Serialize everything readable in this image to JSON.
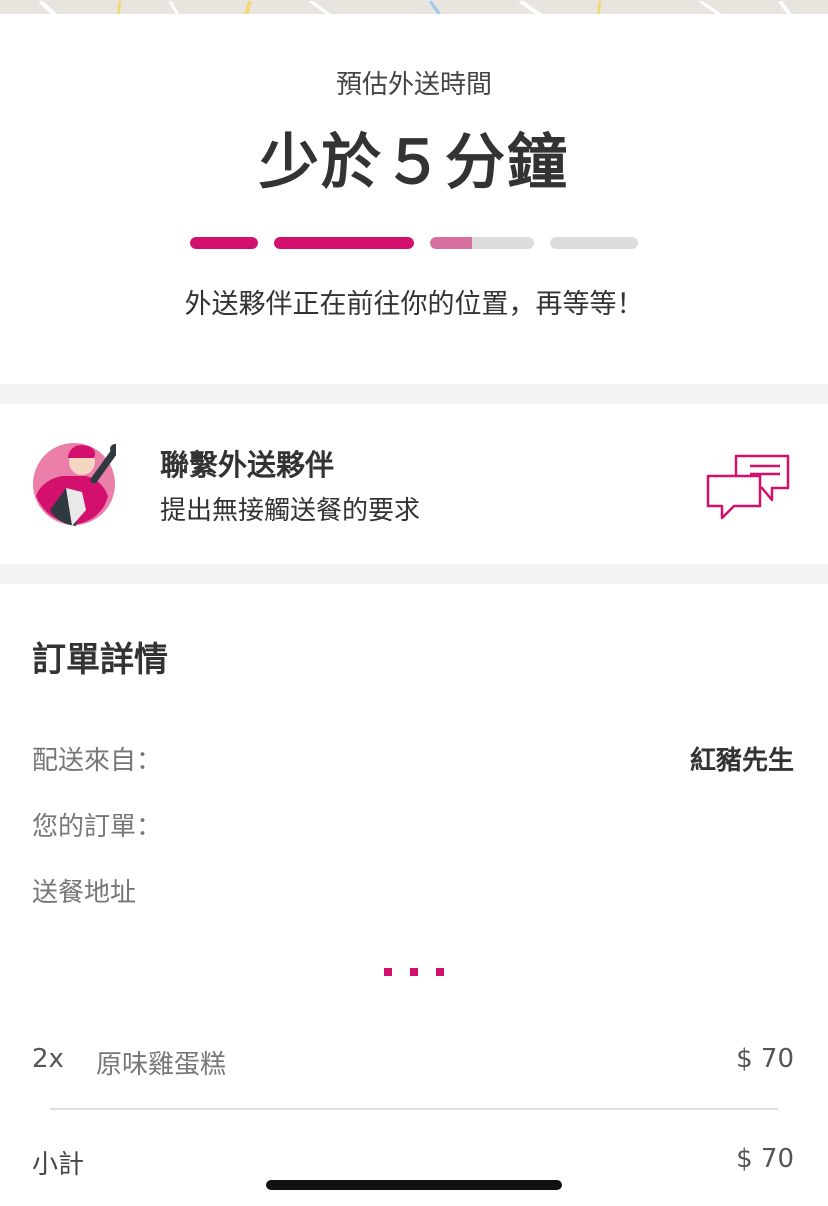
{
  "colors": {
    "accent": "#d3106e",
    "accent_light": "#d8709f",
    "track": "#dcdcdc",
    "band": "#f2f2f2"
  },
  "eta": {
    "label": "預估外送時間",
    "value": "少於５分鐘",
    "progress_steps": [
      {
        "fill": 1.0
      },
      {
        "fill": 1.0
      },
      {
        "fill": 0.4
      },
      {
        "fill": 0.0
      }
    ],
    "status_message": "外送夥伴正在前往你的位置，再等等！"
  },
  "contact": {
    "avatar_icon": "rider-avatar-icon",
    "title": "聯繫外送夥伴",
    "subtitle": "提出無接觸送餐的要求",
    "chat_icon": "chat-bubbles-icon"
  },
  "order": {
    "title": "訂單詳情",
    "delivered_from_label": "配送來自：",
    "delivered_from_value": "紅豬先生",
    "your_order_label": "您的訂單：",
    "address_label": "送餐地址",
    "items": [
      {
        "qty": "2x",
        "name": "原味雞蛋糕",
        "price": "$ 70"
      }
    ],
    "subtotal_label": "小計",
    "subtotal_value": "$ 70"
  }
}
